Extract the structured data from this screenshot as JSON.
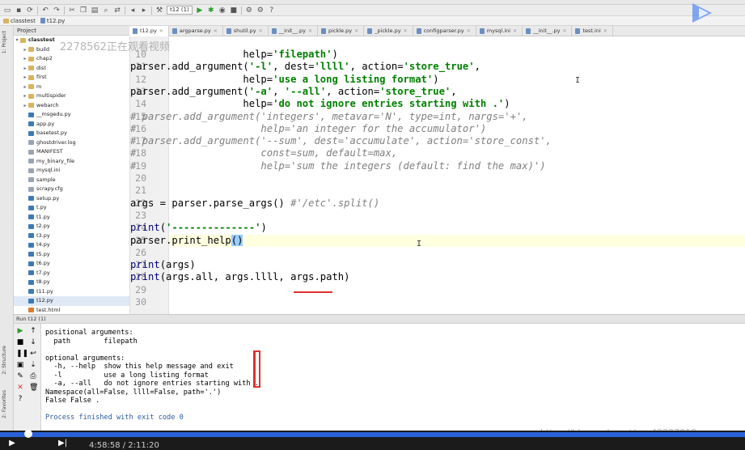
{
  "toolbar": {
    "run_config": "t12 (1)",
    "help": "?"
  },
  "breadcrumb": [
    "classtest",
    "t12.py"
  ],
  "side_labels": {
    "project": "1: Project",
    "structure": "2: Structure",
    "favorites": "2: Favorites"
  },
  "project_panel": {
    "title": "Project",
    "root": "classtest",
    "items": [
      {
        "name": "build",
        "type": "folder"
      },
      {
        "name": "chap2",
        "type": "folder"
      },
      {
        "name": "dist",
        "type": "folder"
      },
      {
        "name": "first",
        "type": "folder"
      },
      {
        "name": "m",
        "type": "folder"
      },
      {
        "name": "multispider",
        "type": "folder"
      },
      {
        "name": "webarch",
        "type": "folder"
      },
      {
        "name": "__msgedu.py",
        "type": "py"
      },
      {
        "name": "app.py",
        "type": "py"
      },
      {
        "name": "basetest.py",
        "type": "py"
      },
      {
        "name": "ghostdriver.log",
        "type": "txt"
      },
      {
        "name": "MANIFEST",
        "type": "txt"
      },
      {
        "name": "my_binary_file",
        "type": "txt"
      },
      {
        "name": "mysql.ini",
        "type": "txt"
      },
      {
        "name": "sample",
        "type": "txt"
      },
      {
        "name": "scrapy.cfg",
        "type": "txt"
      },
      {
        "name": "setup.py",
        "type": "py"
      },
      {
        "name": "t.py",
        "type": "py"
      },
      {
        "name": "t1.py",
        "type": "py"
      },
      {
        "name": "t2.py",
        "type": "py"
      },
      {
        "name": "t3.py",
        "type": "py"
      },
      {
        "name": "t4.py",
        "type": "py"
      },
      {
        "name": "t5.py",
        "type": "py"
      },
      {
        "name": "t6.py",
        "type": "py"
      },
      {
        "name": "t7.py",
        "type": "py"
      },
      {
        "name": "t8.py",
        "type": "py"
      },
      {
        "name": "t11.py",
        "type": "py"
      },
      {
        "name": "t12.py",
        "type": "py"
      },
      {
        "name": "test.html",
        "type": "html"
      }
    ]
  },
  "tabs": [
    {
      "label": "t12.py",
      "active": true
    },
    {
      "label": "argparse.py",
      "active": false
    },
    {
      "label": "shutil.py",
      "active": false
    },
    {
      "label": "__init__.py",
      "active": false
    },
    {
      "label": "pickle.py",
      "active": false
    },
    {
      "label": "_pickle.py",
      "active": false
    },
    {
      "label": "configparser.py",
      "active": false
    },
    {
      "label": "mysql.ini",
      "active": false
    },
    {
      "label": "__init__.py",
      "active": false
    },
    {
      "label": "test.ini",
      "active": false
    }
  ],
  "watermark": "2278562正在观看视频",
  "editor": {
    "lines": [
      {
        "n": "10",
        "parts": [
          [
            "plain",
            "                   "
          ],
          [
            "plain",
            "help="
          ],
          [
            "str",
            "'filepath'"
          ],
          [
            "plain",
            ")"
          ]
        ]
      },
      {
        "n": "11",
        "parts": [
          [
            "plain",
            "parser.add_argument("
          ],
          [
            "str",
            "'-l'"
          ],
          [
            "plain",
            ", dest="
          ],
          [
            "str",
            "'llll'"
          ],
          [
            "plain",
            ", action="
          ],
          [
            "str",
            "'store_true'"
          ],
          [
            "plain",
            ","
          ]
        ]
      },
      {
        "n": "12",
        "parts": [
          [
            "plain",
            "                   help="
          ],
          [
            "str",
            "'use a long listing format'"
          ],
          [
            "plain",
            ")"
          ]
        ]
      },
      {
        "n": "13",
        "parts": [
          [
            "plain",
            "parser.add_argument("
          ],
          [
            "str",
            "'-a'"
          ],
          [
            "plain",
            ", "
          ],
          [
            "str",
            "'--all'"
          ],
          [
            "plain",
            ", action="
          ],
          [
            "str",
            "'store_true'"
          ],
          [
            "plain",
            ","
          ]
        ]
      },
      {
        "n": "14",
        "parts": [
          [
            "plain",
            "                   help="
          ],
          [
            "str",
            "'do not ignore entries starting with .'"
          ],
          [
            "plain",
            ")"
          ]
        ]
      },
      {
        "n": "15",
        "parts": [
          [
            "cmt",
            "# parser.add_argument('integers', metavar='N', type=int, nargs='+',"
          ]
        ]
      },
      {
        "n": "16",
        "parts": [
          [
            "cmt",
            "#                     help='an integer for the accumulator')"
          ]
        ]
      },
      {
        "n": "17",
        "parts": [
          [
            "cmt",
            "# parser.add_argument('--sum', dest='accumulate', action='store_const',"
          ]
        ]
      },
      {
        "n": "18",
        "parts": [
          [
            "cmt",
            "#                     const=sum, default=max,"
          ]
        ]
      },
      {
        "n": "19",
        "parts": [
          [
            "cmt",
            "#                     help='sum the integers (default: find the max)')"
          ]
        ]
      },
      {
        "n": "20",
        "parts": []
      },
      {
        "n": "21",
        "parts": []
      },
      {
        "n": "22",
        "parts": [
          [
            "plain",
            "args = parser.parse_args() "
          ],
          [
            "cmt",
            "#'/etc'.split()"
          ]
        ]
      },
      {
        "n": "23",
        "parts": []
      },
      {
        "n": "24",
        "parts": [
          [
            "fn",
            "print"
          ],
          [
            "plain",
            "("
          ],
          [
            "str",
            "'--------------'"
          ],
          [
            "plain",
            ")"
          ]
        ]
      },
      {
        "n": "25",
        "parts": [
          [
            "plain",
            "parser.print_help"
          ],
          [
            "br",
            "()"
          ]
        ]
      },
      {
        "n": "26",
        "parts": []
      },
      {
        "n": "27",
        "parts": [
          [
            "fn",
            "print"
          ],
          [
            "plain",
            "(args)"
          ]
        ]
      },
      {
        "n": "28",
        "parts": [
          [
            "fn",
            "print"
          ],
          [
            "plain",
            "(args.all, args.llll, args.path)"
          ]
        ]
      },
      {
        "n": "29",
        "parts": []
      },
      {
        "n": "30",
        "parts": []
      }
    ]
  },
  "run_panel": {
    "header": "Run  t12 (1)",
    "output": [
      "positional arguments:",
      "  path        filepath",
      "",
      "optional arguments:",
      "  -h, --help  show this help message and exit",
      "  -l          use a long listing format",
      "  -a, --all   do not ignore entries starting with .",
      "Namespace(all=False, llll=False, path='.')",
      "False False .",
      "",
      "Process finished with exit code 0"
    ]
  },
  "status": {
    "time": "4:58:58 / 2:11:20",
    "url": "https://blog.csdn.net/qq_42227818"
  }
}
